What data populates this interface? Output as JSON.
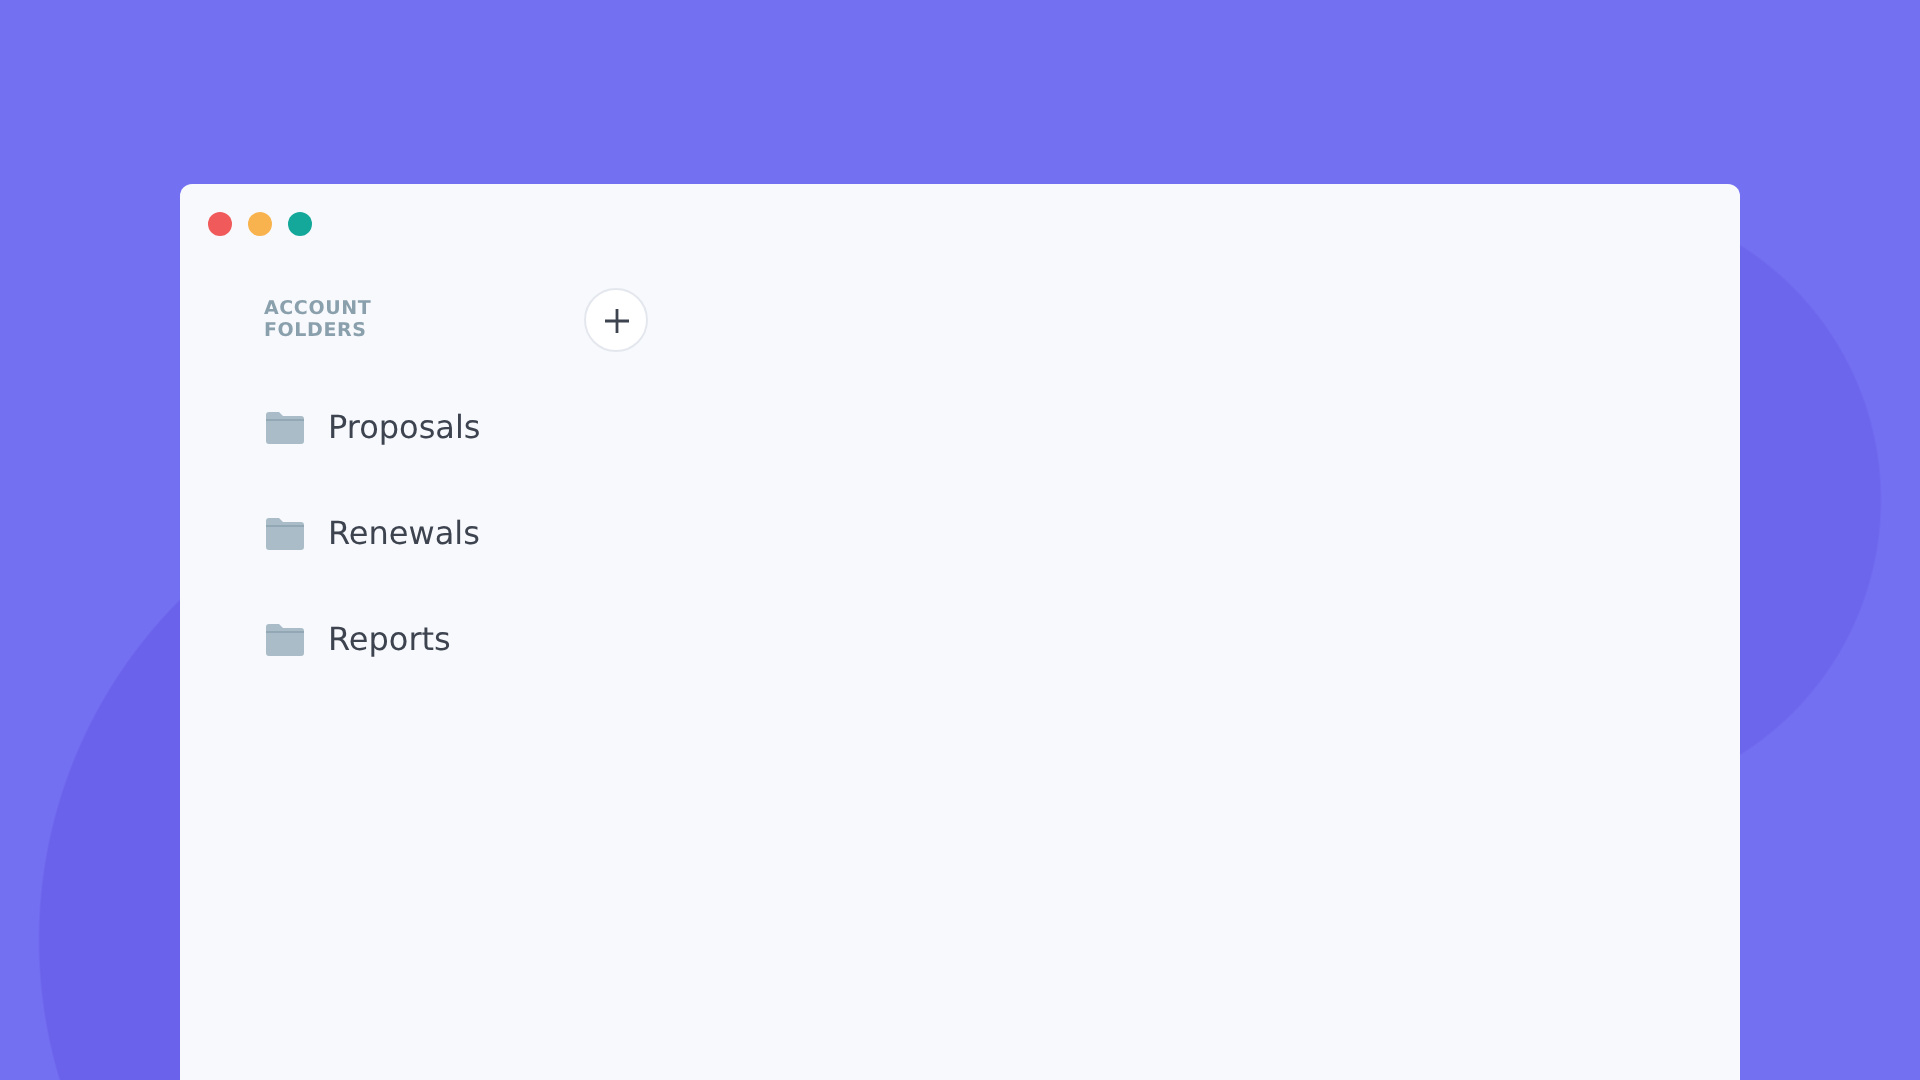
{
  "section": {
    "title": "ACCOUNT FOLDERS"
  },
  "folders": [
    {
      "name": "Proposals"
    },
    {
      "name": "Renewals"
    },
    {
      "name": "Reports"
    }
  ]
}
